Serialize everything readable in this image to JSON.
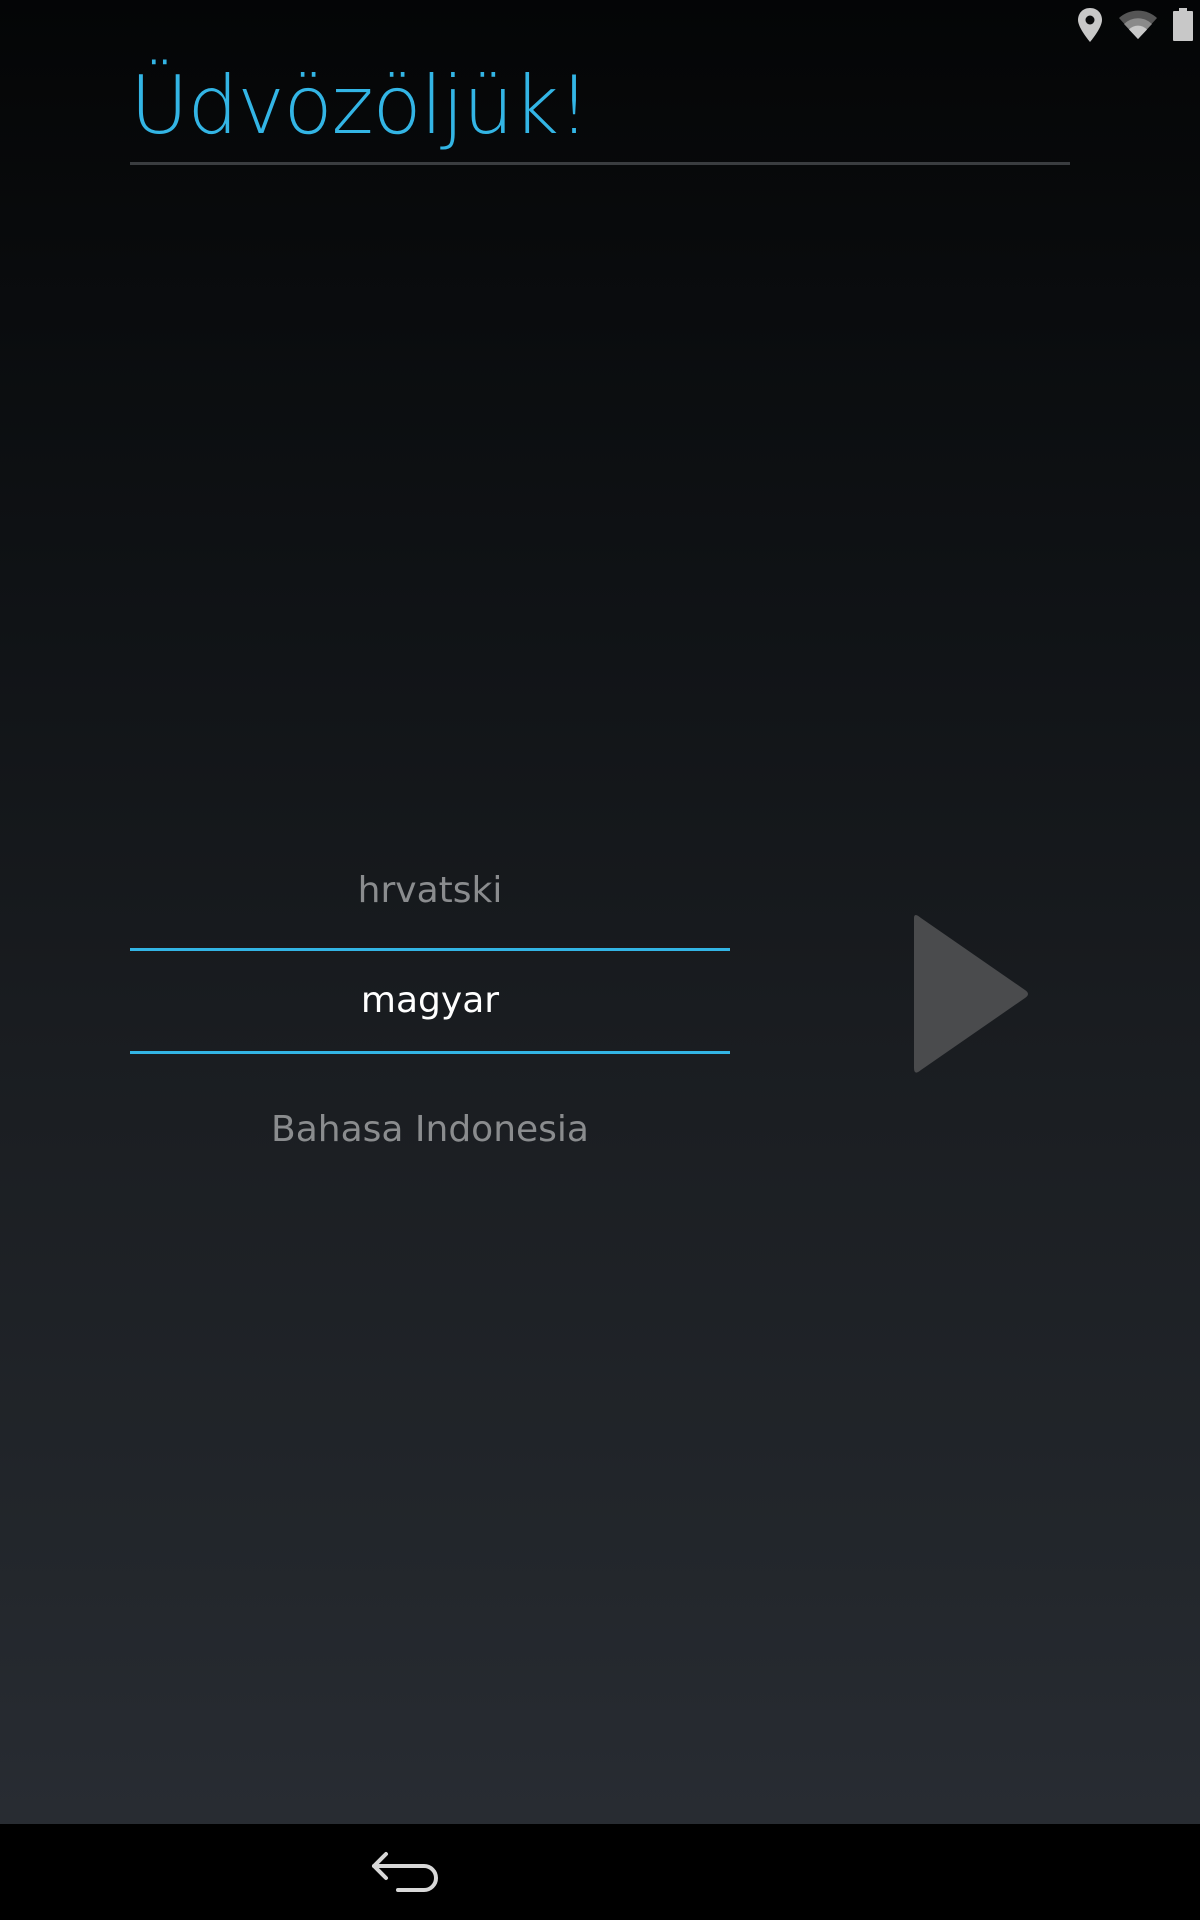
{
  "status_bar": {
    "icons": [
      "location-icon",
      "wifi-icon",
      "battery-icon"
    ]
  },
  "header": {
    "title": "Üdvözöljük!"
  },
  "language_picker": {
    "previous": "hrvatski",
    "selected": "magyar",
    "next": "Bahasa Indonesia"
  },
  "colors": {
    "accent": "#33b5e5",
    "selected_text": "#ffffff",
    "muted_text": "#8a8c8e",
    "start_button": "#4a4b4d"
  },
  "navigation": {
    "icons": [
      "back-icon"
    ]
  }
}
